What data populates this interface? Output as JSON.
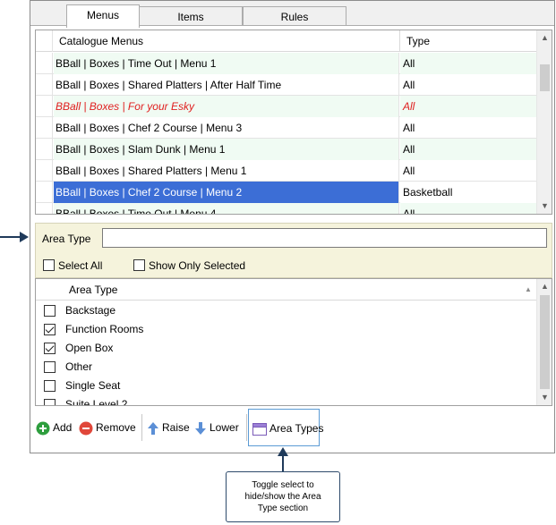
{
  "tabs": [
    {
      "label": "Menus",
      "active": true
    },
    {
      "label": "Items",
      "active": false
    },
    {
      "label": "Rules",
      "active": false
    }
  ],
  "menu_grid": {
    "columns": [
      "Catalogue Menus",
      "Type"
    ],
    "rows": [
      {
        "menu": "BBall | Boxes | Time Out | Menu 1",
        "type": "All"
      },
      {
        "menu": "BBall | Boxes | Shared Platters | After Half Time",
        "type": "All"
      },
      {
        "menu": "BBall | Boxes | For your Esky",
        "type": "All"
      },
      {
        "menu": "BBall | Boxes | Chef 2 Course | Menu 3",
        "type": "All"
      },
      {
        "menu": "BBall | Boxes | Slam Dunk | Menu 1",
        "type": "All"
      },
      {
        "menu": "BBall | Boxes | Shared Platters | Menu 1",
        "type": "All"
      },
      {
        "menu": "BBall | Boxes | Chef 2 Course | Menu 2",
        "type": "Basketball"
      },
      {
        "menu": "BBall | Boxes | Time Out | Menu 4",
        "type": "All"
      }
    ]
  },
  "filter": {
    "label": "Area Type",
    "value": "",
    "select_all_label": "Select All",
    "show_only_selected_label": "Show Only Selected"
  },
  "area_grid": {
    "column": "Area Type",
    "rows": [
      {
        "label": "Backstage",
        "checked": false
      },
      {
        "label": "Function Rooms",
        "checked": true
      },
      {
        "label": "Open Box",
        "checked": true
      },
      {
        "label": "Other",
        "checked": false
      },
      {
        "label": "Single Seat",
        "checked": false
      },
      {
        "label": "Suite Level 2",
        "checked": false
      }
    ]
  },
  "toolbar": {
    "add_label": "Add",
    "remove_label": "Remove",
    "raise_label": "Raise",
    "lower_label": "Lower",
    "area_types_label": "Area Types"
  },
  "callout": {
    "line1": "Toggle select to",
    "line2": "hide/show the Area",
    "line3": "Type section"
  },
  "colors": {
    "selected_row": "#3c6ed6",
    "alt_row": "#f0fbf3",
    "red_text": "#e01e1e",
    "filter_panel": "#f5f3dc",
    "arrow": "#1f3a5a"
  }
}
